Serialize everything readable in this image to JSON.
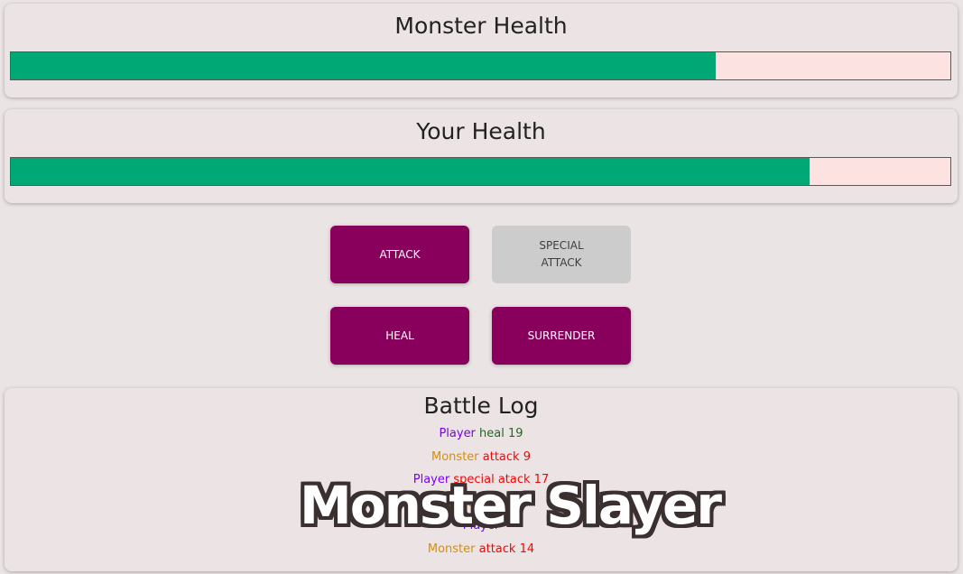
{
  "colors": {
    "health_fill": "#00a876",
    "health_empty": "#fde2e2",
    "button_primary": "#88005b",
    "button_disabled": "#cccccc",
    "player_log": "#7700ff",
    "monster_log": "#da8d00",
    "heal_log": "#1e6b1e",
    "attack_log": "#ff0000"
  },
  "monster": {
    "title": "Monster Health",
    "health_percent": 75
  },
  "player": {
    "title": "Your Health",
    "health_percent": 85
  },
  "controls": {
    "attack_label": "ATTACK",
    "special_label": "SPECIAL ATTACK",
    "special_disabled": true,
    "heal_label": "HEAL",
    "surrender_label": "SURRENDER"
  },
  "log": {
    "title": "Battle Log",
    "entries": [
      {
        "who": "Player",
        "action": "heal",
        "value": "19"
      },
      {
        "who": "Monster",
        "action": "attack",
        "value": "9"
      },
      {
        "who": "Player",
        "action": "special atack",
        "value": "17"
      },
      {
        "who": "Monster",
        "action": "attack",
        "value": ""
      },
      {
        "who": "Player",
        "action": "",
        "value": ""
      },
      {
        "who": "Monster",
        "action": "attack",
        "value": "14"
      }
    ]
  },
  "overlay_title": "Monster Slayer"
}
